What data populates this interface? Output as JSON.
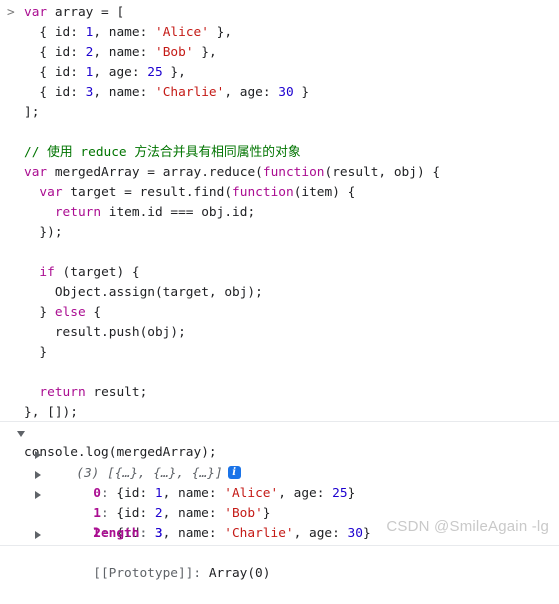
{
  "meta": {
    "prompt_symbol": ">",
    "watermark": "CSDN @SmileAgain -lg"
  },
  "colors": {
    "keyword": "#aa0d91",
    "string": "#c41a16",
    "number": "#1c00cf",
    "comment": "#007400",
    "text": "#202124",
    "muted": "#5f6368",
    "info_badge": "#1a73e8",
    "separator": "#e8eaed",
    "watermark": "#c9c9c9"
  },
  "code": {
    "lines": [
      {
        "id": "l1",
        "prompt": true,
        "tokens": [
          {
            "t": "var",
            "c": "kw"
          },
          {
            "t": " array = [",
            "c": "plain"
          }
        ]
      },
      {
        "id": "l2",
        "prompt": false,
        "tokens": [
          {
            "t": "  { id: ",
            "c": "plain"
          },
          {
            "t": "1",
            "c": "num"
          },
          {
            "t": ", name: ",
            "c": "plain"
          },
          {
            "t": "'Alice'",
            "c": "str"
          },
          {
            "t": " },",
            "c": "plain"
          }
        ]
      },
      {
        "id": "l3",
        "prompt": false,
        "tokens": [
          {
            "t": "  { id: ",
            "c": "plain"
          },
          {
            "t": "2",
            "c": "num"
          },
          {
            "t": ", name: ",
            "c": "plain"
          },
          {
            "t": "'Bob'",
            "c": "str"
          },
          {
            "t": " },",
            "c": "plain"
          }
        ]
      },
      {
        "id": "l4",
        "prompt": false,
        "tokens": [
          {
            "t": "  { id: ",
            "c": "plain"
          },
          {
            "t": "1",
            "c": "num"
          },
          {
            "t": ", age: ",
            "c": "plain"
          },
          {
            "t": "25",
            "c": "num"
          },
          {
            "t": " },",
            "c": "plain"
          }
        ]
      },
      {
        "id": "l5",
        "prompt": false,
        "tokens": [
          {
            "t": "  { id: ",
            "c": "plain"
          },
          {
            "t": "3",
            "c": "num"
          },
          {
            "t": ", name: ",
            "c": "plain"
          },
          {
            "t": "'Charlie'",
            "c": "str"
          },
          {
            "t": ", age: ",
            "c": "plain"
          },
          {
            "t": "30",
            "c": "num"
          },
          {
            "t": " }",
            "c": "plain"
          }
        ]
      },
      {
        "id": "l6",
        "prompt": false,
        "tokens": [
          {
            "t": "];",
            "c": "plain"
          }
        ]
      },
      {
        "id": "l7",
        "prompt": false,
        "tokens": [
          {
            "t": "",
            "c": "plain"
          }
        ]
      },
      {
        "id": "l8",
        "prompt": false,
        "tokens": [
          {
            "t": "// 使用 reduce 方法合并具有相同属性的对象",
            "c": "cmt"
          }
        ]
      },
      {
        "id": "l9",
        "prompt": false,
        "tokens": [
          {
            "t": "var",
            "c": "kw"
          },
          {
            "t": " mergedArray = array.reduce(",
            "c": "plain"
          },
          {
            "t": "function",
            "c": "fn"
          },
          {
            "t": "(result, obj) {",
            "c": "plain"
          }
        ]
      },
      {
        "id": "l10",
        "prompt": false,
        "tokens": [
          {
            "t": "  ",
            "c": "plain"
          },
          {
            "t": "var",
            "c": "kw"
          },
          {
            "t": " target = result.find(",
            "c": "plain"
          },
          {
            "t": "function",
            "c": "fn"
          },
          {
            "t": "(item) {",
            "c": "plain"
          }
        ]
      },
      {
        "id": "l11",
        "prompt": false,
        "tokens": [
          {
            "t": "    ",
            "c": "plain"
          },
          {
            "t": "return",
            "c": "kw"
          },
          {
            "t": " item.id === obj.id;",
            "c": "plain"
          }
        ]
      },
      {
        "id": "l12",
        "prompt": false,
        "tokens": [
          {
            "t": "  });",
            "c": "plain"
          }
        ]
      },
      {
        "id": "l13",
        "prompt": false,
        "tokens": [
          {
            "t": "",
            "c": "plain"
          }
        ]
      },
      {
        "id": "l14",
        "prompt": false,
        "tokens": [
          {
            "t": "  ",
            "c": "plain"
          },
          {
            "t": "if",
            "c": "kw"
          },
          {
            "t": " (target) {",
            "c": "plain"
          }
        ]
      },
      {
        "id": "l15",
        "prompt": false,
        "tokens": [
          {
            "t": "    Object.assign(target, obj);",
            "c": "plain"
          }
        ]
      },
      {
        "id": "l16",
        "prompt": false,
        "tokens": [
          {
            "t": "  } ",
            "c": "plain"
          },
          {
            "t": "else",
            "c": "kw"
          },
          {
            "t": " {",
            "c": "plain"
          }
        ]
      },
      {
        "id": "l17",
        "prompt": false,
        "tokens": [
          {
            "t": "    result.push(obj);",
            "c": "plain"
          }
        ]
      },
      {
        "id": "l18",
        "prompt": false,
        "tokens": [
          {
            "t": "  }",
            "c": "plain"
          }
        ]
      },
      {
        "id": "l19",
        "prompt": false,
        "tokens": [
          {
            "t": "",
            "c": "plain"
          }
        ]
      },
      {
        "id": "l20",
        "prompt": false,
        "tokens": [
          {
            "t": "  ",
            "c": "plain"
          },
          {
            "t": "return",
            "c": "kw"
          },
          {
            "t": " result;",
            "c": "plain"
          }
        ]
      },
      {
        "id": "l21",
        "prompt": false,
        "tokens": [
          {
            "t": "}, []);",
            "c": "plain"
          }
        ]
      },
      {
        "id": "l22",
        "prompt": false,
        "tokens": [
          {
            "t": "",
            "c": "plain"
          }
        ]
      },
      {
        "id": "l23",
        "prompt": false,
        "tokens": [
          {
            "t": "console.log(mergedArray);",
            "c": "plain"
          }
        ]
      }
    ]
  },
  "console_output": {
    "summary": {
      "count_label": "(3)",
      "preview": "[{…}, {…}, {…}]",
      "info_glyph": "i",
      "expanded": true
    },
    "entries": [
      {
        "index": "0",
        "separator": ": ",
        "tokens": [
          {
            "t": "{id: ",
            "c": "objtxt"
          },
          {
            "t": "1",
            "c": "num"
          },
          {
            "t": ", name: ",
            "c": "objtxt"
          },
          {
            "t": "'Alice'",
            "c": "str"
          },
          {
            "t": ", age: ",
            "c": "objtxt"
          },
          {
            "t": "25",
            "c": "num"
          },
          {
            "t": "}",
            "c": "objtxt"
          }
        ]
      },
      {
        "index": "1",
        "separator": ": ",
        "tokens": [
          {
            "t": "{id: ",
            "c": "objtxt"
          },
          {
            "t": "2",
            "c": "num"
          },
          {
            "t": ", name: ",
            "c": "objtxt"
          },
          {
            "t": "'Bob'",
            "c": "str"
          },
          {
            "t": "}",
            "c": "objtxt"
          }
        ]
      },
      {
        "index": "2",
        "separator": ": ",
        "tokens": [
          {
            "t": "{id: ",
            "c": "objtxt"
          },
          {
            "t": "3",
            "c": "num"
          },
          {
            "t": ", name: ",
            "c": "objtxt"
          },
          {
            "t": "'Charlie'",
            "c": "str"
          },
          {
            "t": ", age: ",
            "c": "objtxt"
          },
          {
            "t": "30",
            "c": "num"
          },
          {
            "t": "}",
            "c": "objtxt"
          }
        ]
      }
    ],
    "length_row": {
      "key": "length",
      "separator": ": ",
      "value": "3"
    },
    "prototype_row": {
      "key": "[[Prototype]]",
      "separator": ": ",
      "value": "Array(0)"
    }
  }
}
